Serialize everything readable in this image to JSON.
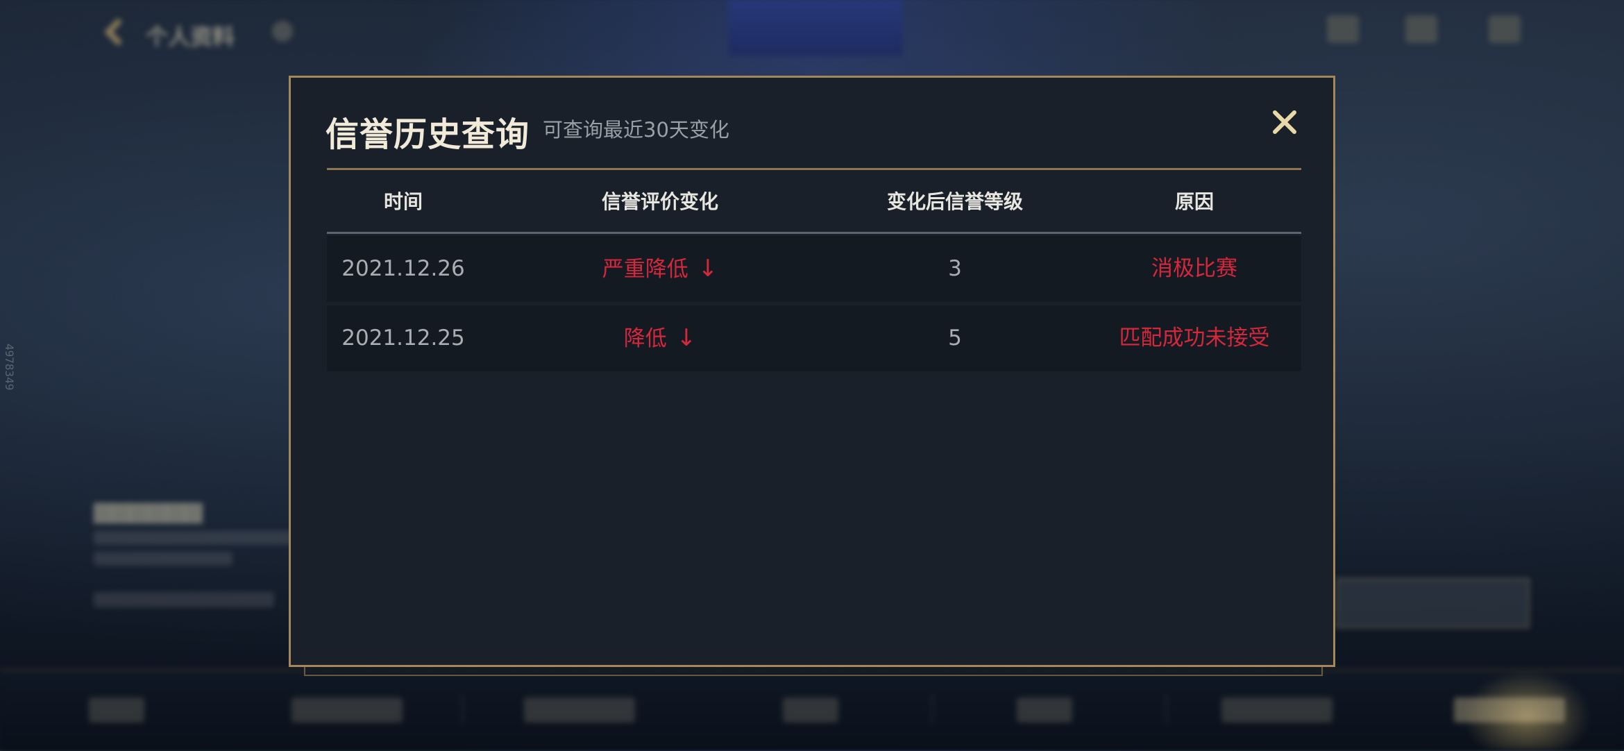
{
  "background": {
    "title": "个人资料",
    "side_id": "4978349"
  },
  "modal": {
    "title": "信誉历史查询",
    "subtitle": "可查询最近30天变化",
    "close_icon": "close-icon",
    "columns": [
      "时间",
      "信誉评价变化",
      "变化后信誉等级",
      "原因"
    ],
    "rows": [
      {
        "time": "2021.12.26",
        "change": "严重降低",
        "arrow": "↓",
        "level": "3",
        "reason": "消极比赛"
      },
      {
        "time": "2021.12.25",
        "change": "降低",
        "arrow": "↓",
        "level": "5",
        "reason": "匹配成功未接受"
      }
    ]
  },
  "colors": {
    "accent_gold": "#a4885a",
    "negative_red": "#d5283c"
  }
}
